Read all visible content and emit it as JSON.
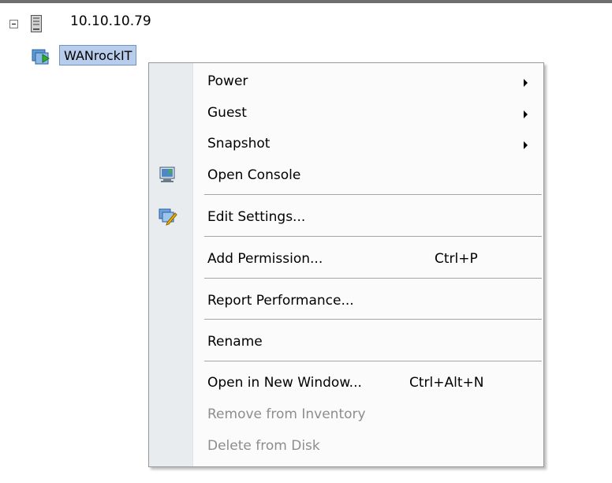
{
  "tree": {
    "host_label": "10.10.10.79",
    "vm_label": "WANrockIT"
  },
  "menu": {
    "items": [
      {
        "label": "Power",
        "submenu": true
      },
      {
        "label": "Guest",
        "submenu": true
      },
      {
        "label": "Snapshot",
        "submenu": true
      },
      {
        "label": "Open Console",
        "icon": "console-icon"
      },
      {
        "label": "Edit Settings...",
        "icon": "edit-settings-icon"
      },
      {
        "label": "Add Permission...",
        "shortcut": "Ctrl+P"
      },
      {
        "label": "Report Performance..."
      },
      {
        "label": "Rename"
      },
      {
        "label": "Open in New Window...",
        "shortcut": "Ctrl+Alt+N"
      },
      {
        "label": "Remove from Inventory",
        "disabled": true
      },
      {
        "label": "Delete from Disk",
        "disabled": true
      }
    ]
  },
  "colors": {
    "selection_bg": "#b8cdeb",
    "gutter_bg": "#e9ecee",
    "disabled_text": "#8d8d8d"
  }
}
